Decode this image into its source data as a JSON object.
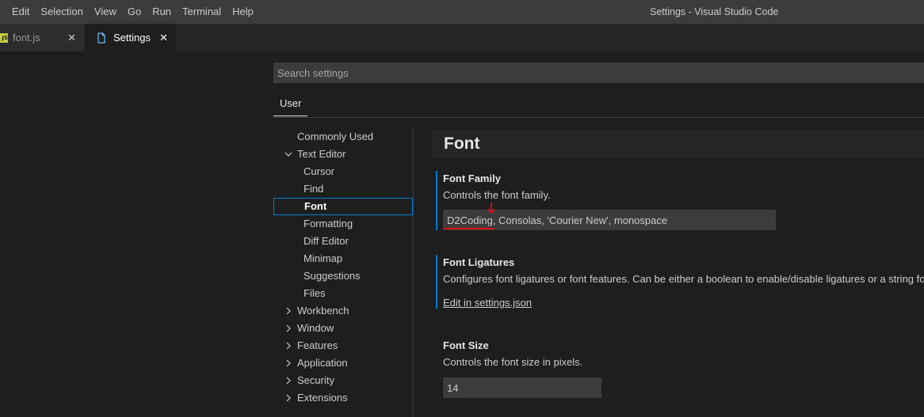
{
  "menu": [
    "Edit",
    "Selection",
    "View",
    "Go",
    "Run",
    "Terminal",
    "Help"
  ],
  "window_title": "Settings - Visual Studio Code",
  "tabs": [
    {
      "label": "font.js",
      "icon": "js-file-icon",
      "close": "✕"
    },
    {
      "label": "Settings",
      "icon": "settings-file-icon",
      "close": "✕"
    }
  ],
  "search": {
    "placeholder": "Search settings"
  },
  "scope_tab": "User",
  "toc": [
    {
      "label": "Commonly Used"
    },
    {
      "label": "Text Editor",
      "expanded": true
    },
    {
      "label": "Cursor"
    },
    {
      "label": "Find"
    },
    {
      "label": "Font",
      "selected": true
    },
    {
      "label": "Formatting"
    },
    {
      "label": "Diff Editor"
    },
    {
      "label": "Minimap"
    },
    {
      "label": "Suggestions"
    },
    {
      "label": "Files"
    },
    {
      "label": "Workbench"
    },
    {
      "label": "Window"
    },
    {
      "label": "Features"
    },
    {
      "label": "Application"
    },
    {
      "label": "Security"
    },
    {
      "label": "Extensions"
    }
  ],
  "section_title": "Font",
  "settings": {
    "font_family": {
      "title": "Font Family",
      "description": "Controls the font family.",
      "value": "D2Coding, Consolas, 'Courier New', monospace"
    },
    "font_ligatures": {
      "title": "Font Ligatures",
      "description": "Configures font ligatures or font features. Can be either a boolean to enable/disable ligatures or a string for the value of the CSS 'font-feature-settings' property.",
      "link": "Edit in settings.json"
    },
    "font_size": {
      "title": "Font Size",
      "description": "Controls the font size in pixels.",
      "value": "14"
    }
  },
  "colors": {
    "accent": "#007acc",
    "annotation": "#e01010",
    "js_badge": "#cbcb41"
  }
}
